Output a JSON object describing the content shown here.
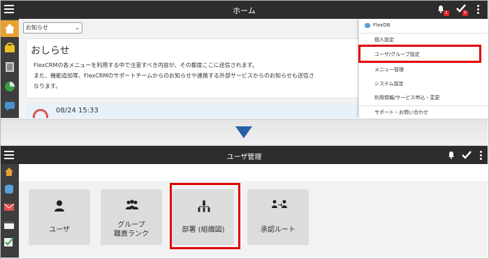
{
  "top": {
    "title": "ホーム",
    "filter_select": "お知らせ",
    "notice_title": "おしらせ",
    "notice_lines": [
      "FlexCRMの各メニューを利用する中で注意すべき内容が、その都度ここに送信されます。",
      "また、機能追加等、FlexCRMのサポートチームからのお知らせや連携する外部サービスからのお知らせも送信さ",
      "なります。"
    ],
    "notice_date": "08/24 15:33",
    "bell_badge": "1",
    "check_badge": "5",
    "menu": {
      "header": "FlexDB",
      "items": [
        "個人設定",
        "ユーザ/グループ設定",
        "メニュー管理",
        "システム設定",
        "利用情報/サービス申込・変更",
        "サポート・お問い合わせ"
      ]
    }
  },
  "bottom": {
    "title": "ユーザ管理",
    "tiles": [
      {
        "label": "ユーザ",
        "icon": "user-icon"
      },
      {
        "label_line1": "グループ",
        "label_line2": "職責ランク",
        "icon": "group-icon"
      },
      {
        "label": "部署 (組織図)",
        "icon": "org-chart-icon"
      },
      {
        "label": "承認ルート",
        "icon": "approval-route-icon"
      }
    ]
  },
  "colors": {
    "header_bg": "#2d2d2d",
    "sidebar_bg": "#3d3d3d",
    "highlight": "#e00000",
    "arrow": "#2a5fa8",
    "active_sidebar": "#e8a234"
  }
}
